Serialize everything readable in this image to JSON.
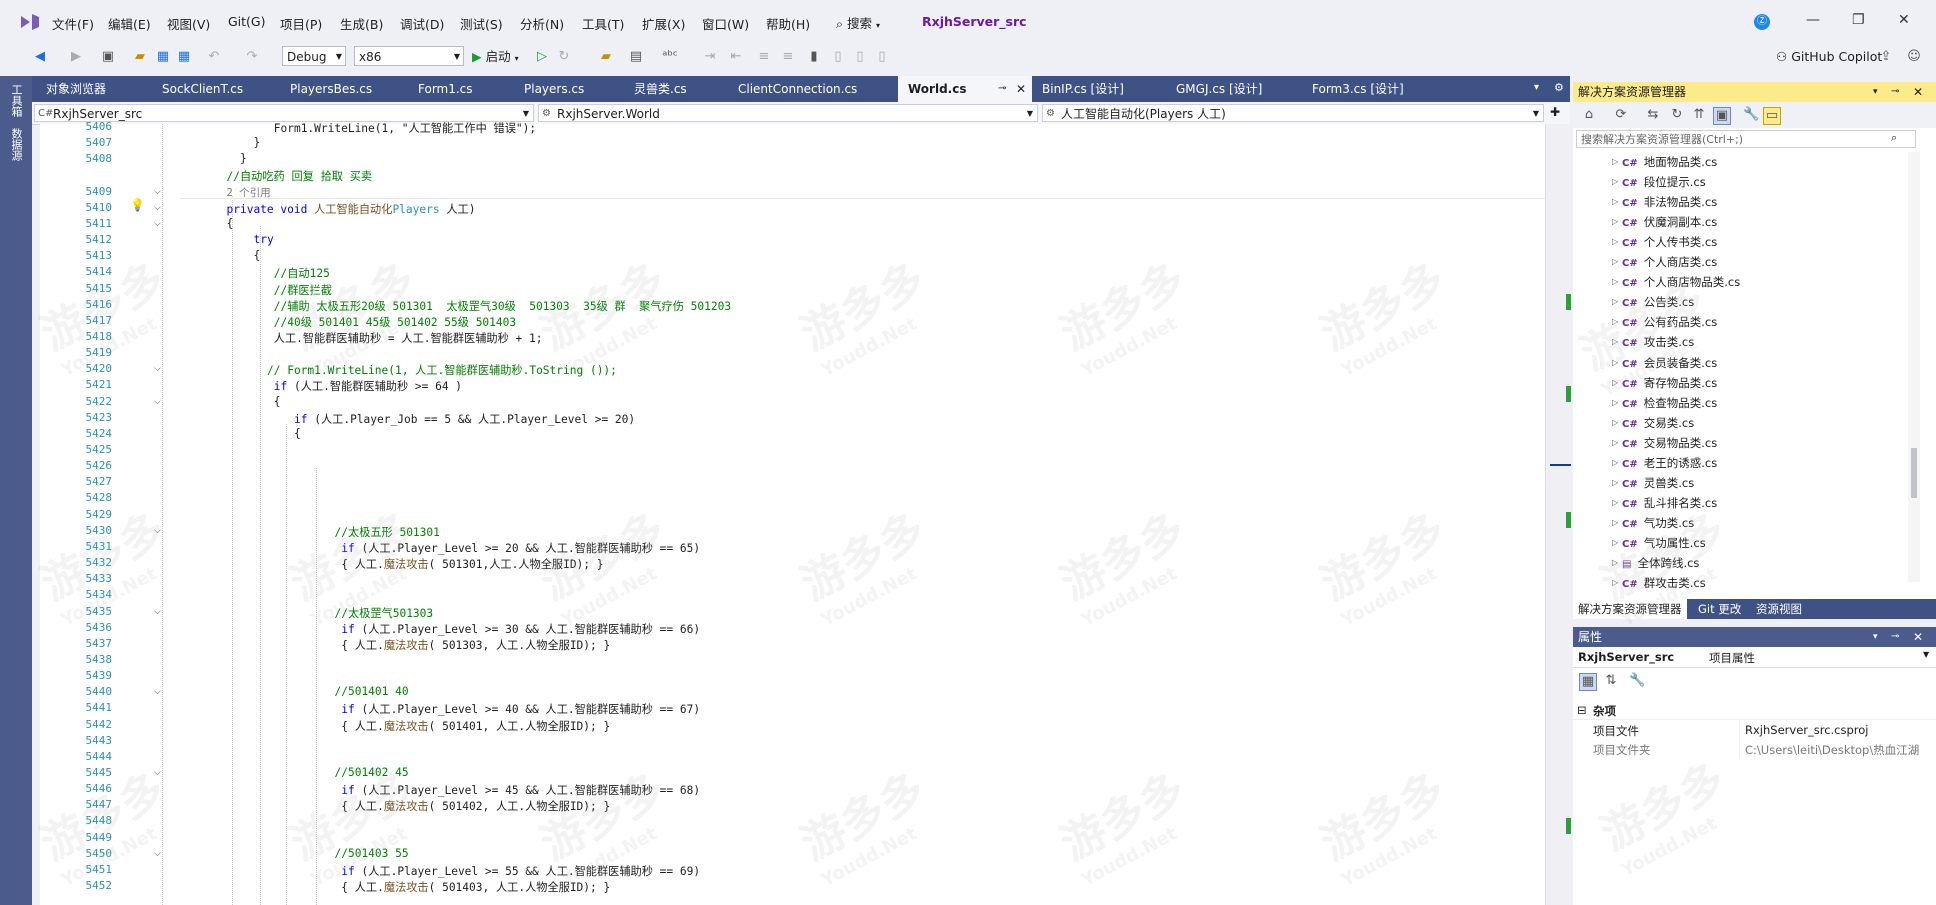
{
  "menubar": {
    "items": [
      "文件(F)",
      "编辑(E)",
      "视图(V)",
      "Git(G)",
      "项目(P)",
      "生成(B)",
      "调试(D)",
      "测试(S)",
      "分析(N)",
      "工具(T)",
      "扩展(X)",
      "窗口(W)",
      "帮助(H)"
    ],
    "search_label": "搜索",
    "project_name": "RxjhServer_src"
  },
  "toolbar": {
    "config": "Debug",
    "platform": "x86",
    "start_label": "启动",
    "copilot_label": "GitHub Copilot"
  },
  "left_strip": {
    "tabs": [
      "工具箱",
      "数据源"
    ]
  },
  "editor_tabs": [
    {
      "label": "对象浏览器",
      "active": false
    },
    {
      "label": "SockClienT.cs",
      "active": false
    },
    {
      "label": "PlayersBes.cs",
      "active": false
    },
    {
      "label": "Form1.cs",
      "active": false
    },
    {
      "label": "Players.cs",
      "active": false
    },
    {
      "label": "灵兽类.cs",
      "active": false
    },
    {
      "label": "ClientConnection.cs",
      "active": false
    },
    {
      "label": "World.cs",
      "active": true
    },
    {
      "label": "BinIP.cs [设计]",
      "active": false
    },
    {
      "label": "GMGJ.cs [设计]",
      "active": false
    },
    {
      "label": "Form3.cs [设计]",
      "active": false
    }
  ],
  "navbar": {
    "project": "RxjhServer_src",
    "class": "RxjhServer.World",
    "member": "人工智能自动化(Players 人工)"
  },
  "code": {
    "line_numbers": [
      "5406",
      "5407",
      "5408",
      "",
      "5409",
      "5410",
      "5411",
      "5412",
      "5413",
      "5414",
      "5415",
      "5416",
      "5417",
      "5418",
      "5419",
      "5420",
      "5421",
      "5422",
      "5423",
      "5424",
      "5425",
      "5426",
      "5427",
      "5428",
      "5429",
      "5430",
      "5431",
      "5432",
      "5433",
      "5434",
      "5435",
      "5436",
      "5437",
      "5438",
      "5439",
      "5440",
      "5441",
      "5442",
      "5443",
      "5444",
      "5445",
      "5446",
      "5447",
      "5448",
      "5449",
      "5450",
      "5451",
      "5452"
    ],
    "lines": {
      "l5406": "Form1.WriteLine(1, \"人工智能工作中 错误\");",
      "l5407": "}",
      "l5408": "}",
      "c_auto": "//自动吃药 回复 拾取 买卖",
      "refs": "2 个引用",
      "sig_private": "private",
      "sig_void": "void",
      "sig_name": "人工智能自动化",
      "sig_type": "Players",
      "sig_param": "人工)",
      "open1": "{",
      "try": "try",
      "open2": "{",
      "c125": "//自动125",
      "cgroup": "//群医拦截",
      "chelp": "//辅助 太极五形20级 501301  太极罡气30级  501303  35级 群  聚气疗伤 501203",
      "c40": "//40级 501401 45级 501402 55级 501403",
      "assign": "人工.智能群医辅助秒 = 人工.智能群医辅助秒 + 1;",
      "cform": "// Form1.WriteLine(1, 人工.智能群医辅助秒.ToString ());",
      "if64": "(人工.智能群医辅助秒 >= 64 )",
      "open3": "{",
      "ifjob": "(人工.Player_Job == 5 && 人工.Player_Level >= 20)",
      "open4": "{",
      "c501301": "//太极五形 501301",
      "if65": "(人工.Player_Level >= 20 && 人工.智能群医辅助秒 == 65)",
      "call65": "( 501301,人工.人物全服ID); }",
      "c501303": "//太极罡气501303",
      "if66": "(人工.Player_Level >= 30 && 人工.智能群医辅助秒 == 66)",
      "call66": "( 501303, 人工.人物全服ID); }",
      "c501401": "//501401 40",
      "if67": "(人工.Player_Level >= 40 && 人工.智能群医辅助秒 == 67)",
      "call67": "( 501401, 人工.人物全服ID); }",
      "c501402": "//501402 45",
      "if68": "(人工.Player_Level >= 45 && 人工.智能群医辅助秒 == 68)",
      "call68": "( 501402, 人工.人物全服ID); }",
      "c501403": "//501403 55",
      "if69": "(人工.Player_Level >= 55 && 人工.智能群医辅助秒 == 69)",
      "call69": "( 501403, 人工.人物全服ID); }",
      "kw_if": "if",
      "call_prefix": "{ 人工.",
      "call_method": "魔法攻击"
    }
  },
  "solution_explorer": {
    "title": "解决方案资源管理器",
    "search_placeholder": "搜索解决方案资源管理器(Ctrl+;)",
    "items": [
      "地面物品类.cs",
      "段位提示.cs",
      "非法物品类.cs",
      "伏魔洞副本.cs",
      "个人传书类.cs",
      "个人商店类.cs",
      "个人商店物品类.cs",
      "公告类.cs",
      "公有药品类.cs",
      "攻击类.cs",
      "会员装备类.cs",
      "寄存物品类.cs",
      "检查物品类.cs",
      "交易类.cs",
      "交易物品类.cs",
      "老王的诱惑.cs",
      "灵兽类.cs",
      "乱斗排名类.cs",
      "气功类.cs",
      "气功属性.cs",
      "全体跨线.cs",
      "群攻击类.cs"
    ],
    "tabs": [
      "解决方案资源管理器",
      "Git 更改",
      "资源视图"
    ]
  },
  "properties": {
    "title": "属性",
    "object": "RxjhServer_src",
    "object_kind": "项目属性",
    "category": "杂项",
    "rows": [
      {
        "name": "项目文件",
        "value": "RxjhServer_src.csproj"
      },
      {
        "name": "项目文件夹",
        "value": "C:\\Users\\leiti\\Desktop\\热血江湖"
      }
    ]
  },
  "watermark": {
    "text": "游多多",
    "sub": "Youdd.Net"
  },
  "colors": {
    "accent": "#3f5285",
    "active_title": "#fbeb8b",
    "comment": "#008000",
    "keyword": "#0000ff",
    "type": "#2b91af"
  }
}
